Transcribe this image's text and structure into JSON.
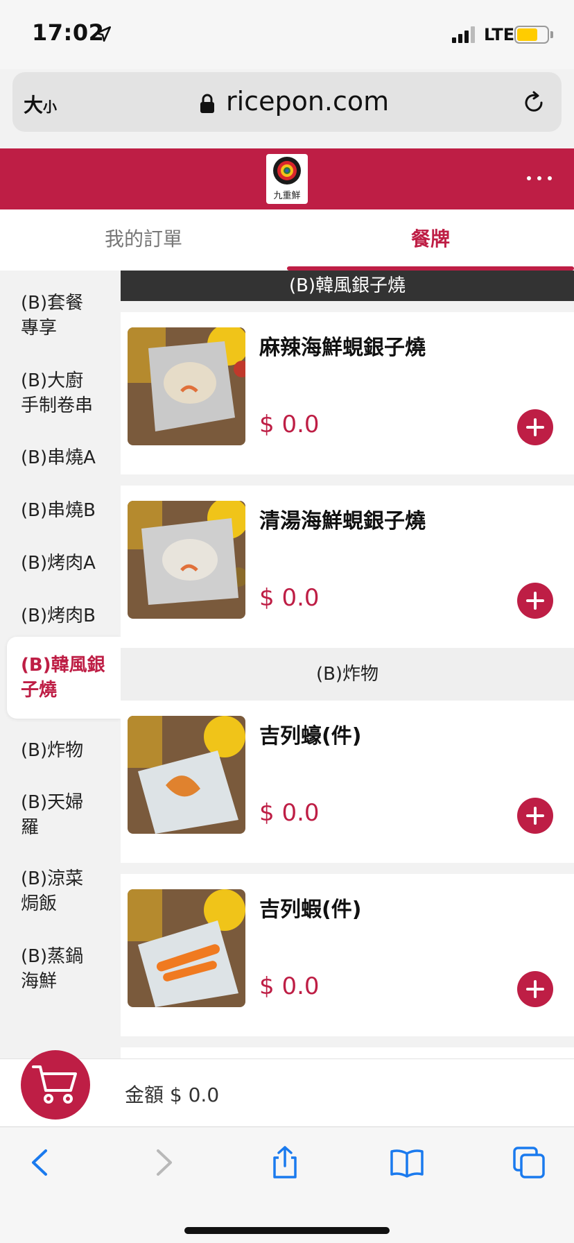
{
  "status_bar": {
    "time": "17:02",
    "network": "LTE",
    "battery_level": 0.7,
    "icons": [
      "location-arrow-icon",
      "signal-bars-icon",
      "battery-icon"
    ]
  },
  "browser": {
    "text_size_big": "大",
    "text_size_small": "小",
    "url": "ricepon.com",
    "icons": [
      "lock-icon",
      "reload-icon"
    ]
  },
  "app": {
    "logo_text": "九重鮮",
    "brand_color": "#be1e45",
    "more_icon": "more-dots-icon"
  },
  "tabs": {
    "orders": "我的訂單",
    "menu": "餐牌",
    "active": "menu"
  },
  "sidebar": {
    "items": [
      {
        "line1": "(B)套餐",
        "line2": "專享"
      },
      {
        "line1": "(B)大廚",
        "line2": "手制卷串"
      },
      {
        "line1": "(B)串燒A",
        "line2": ""
      },
      {
        "line1": "(B)串燒B",
        "line2": ""
      },
      {
        "line1": "(B)烤肉A",
        "line2": ""
      },
      {
        "line1": "(B)烤肉B",
        "line2": ""
      },
      {
        "line1": "(B)韓風銀",
        "line2": "子燒"
      },
      {
        "line1": "(B)炸物",
        "line2": ""
      },
      {
        "line1": "(B)天婦",
        "line2": "羅"
      },
      {
        "line1": "(B)涼菜",
        "line2": "焗飯"
      },
      {
        "line1": "(B)蒸鍋",
        "line2": "海鮮"
      }
    ],
    "active_index": 6
  },
  "menu": {
    "sections": [
      {
        "title": "(B)韓風銀子燒",
        "items": [
          {
            "name": "麻辣海鮮蜆銀子燒",
            "price": "$ 0.0"
          },
          {
            "name": "清湯海鮮蜆銀子燒",
            "price": "$ 0.0"
          }
        ]
      },
      {
        "title": "(B)炸物",
        "items": [
          {
            "name": "吉列蠔(件)",
            "price": "$ 0.0"
          },
          {
            "name": "吉列蝦(件)",
            "price": "$ 0.0"
          }
        ]
      }
    ]
  },
  "cart": {
    "total_label": "金額 $ 0.0",
    "icon": "cart-icon"
  },
  "toolbar": {
    "icons": [
      "back-icon",
      "forward-icon",
      "share-icon",
      "bookmarks-icon",
      "tabs-icon"
    ]
  }
}
